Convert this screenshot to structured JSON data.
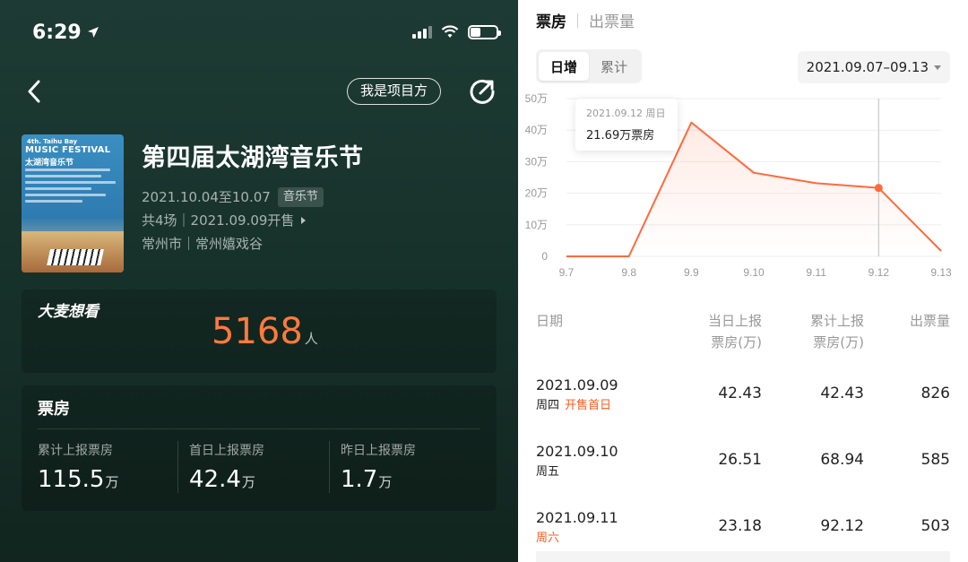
{
  "status_bar": {
    "time": "6:29"
  },
  "nav": {
    "organizer_label": "我是项目方"
  },
  "event": {
    "poster": {
      "line1": "4th. Taihu Bay",
      "line2": "MUSIC FESTIVAL",
      "line3": "太湖湾音乐节"
    },
    "title": "第四届太湖湾音乐节",
    "dates": "2021.10.04至10.07",
    "tag": "音乐节",
    "sessions": "共4场｜2021.09.09开售",
    "location": "常州市｜常州嬉戏谷"
  },
  "want": {
    "logo_text": "大麦想看",
    "count": "5168",
    "unit": "人"
  },
  "boxoffice": {
    "title": "票房",
    "stats": [
      {
        "label": "累计上报票房",
        "value": "115.5",
        "unit": "万"
      },
      {
        "label": "首日上报票房",
        "value": "42.4",
        "unit": "万"
      },
      {
        "label": "昨日上报票房",
        "value": "1.7",
        "unit": "万"
      }
    ]
  },
  "right": {
    "tabs": [
      "票房",
      "出票量"
    ],
    "segment": [
      "日增",
      "累计"
    ],
    "date_range": "2021.09.07–09.13",
    "tooltip": {
      "date": "2021.09.12 周日",
      "value": "21.69万票房"
    },
    "table": {
      "headers": [
        "日期",
        "当日上报\n票房(万)",
        "累计上报\n票房(万)",
        "出票量"
      ],
      "rows": [
        {
          "date": "2021.09.09",
          "weekday": "周四",
          "note": "开售首日",
          "weekday_highlight": false,
          "daily": "42.43",
          "cumulative": "42.43",
          "tickets": "826"
        },
        {
          "date": "2021.09.10",
          "weekday": "周五",
          "note": "",
          "weekday_highlight": false,
          "daily": "26.51",
          "cumulative": "68.94",
          "tickets": "585"
        },
        {
          "date": "2021.09.11",
          "weekday": "周六",
          "note": "",
          "weekday_highlight": true,
          "daily": "23.18",
          "cumulative": "92.12",
          "tickets": "503"
        }
      ]
    }
  },
  "colors": {
    "accent": "#ff7a3d",
    "line": "#ff6a3d",
    "highlight": "#ff5a1f",
    "bg_left": "#1d3b34"
  },
  "chart_data": {
    "type": "area",
    "categories": [
      "9.7",
      "9.8",
      "9.9",
      "9.10",
      "9.11",
      "9.12",
      "9.13"
    ],
    "values": [
      0,
      0,
      42.43,
      26.51,
      23.18,
      21.69,
      1.7
    ],
    "y_ticks": [
      "0",
      "10万",
      "20万",
      "30万",
      "40万",
      "50万"
    ],
    "ylim": [
      0,
      50
    ],
    "highlight_index": 5,
    "grid": true
  }
}
